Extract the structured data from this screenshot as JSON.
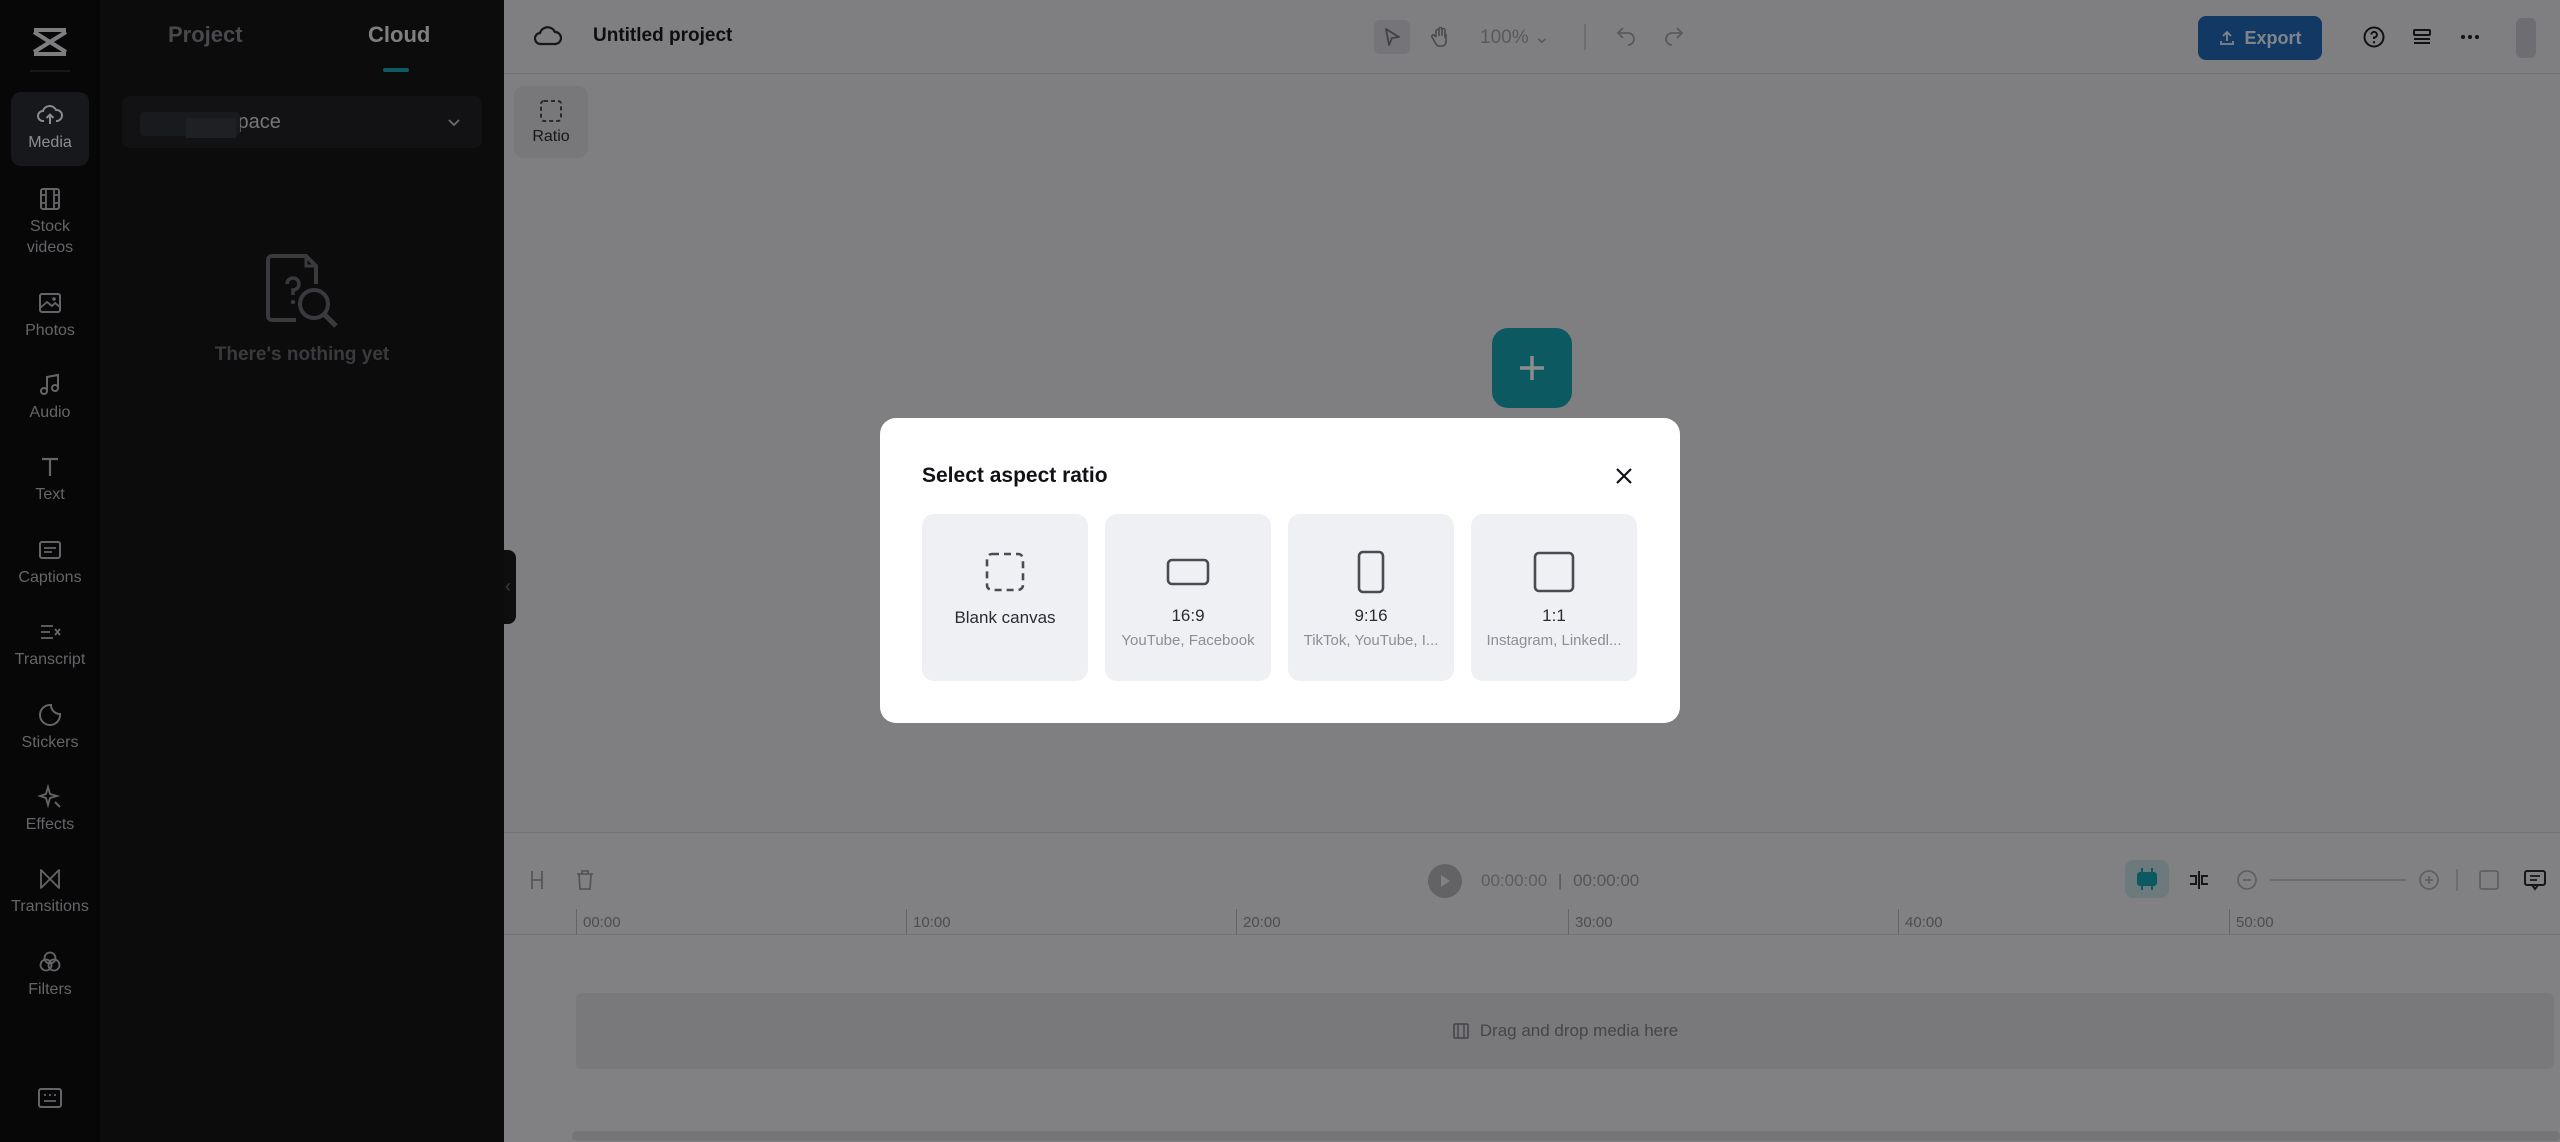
{
  "rail": {
    "items": [
      {
        "label": "Media",
        "icon": "cloud-upload-icon",
        "active": true
      },
      {
        "label": "Stock videos",
        "icon": "film-icon"
      },
      {
        "label": "Photos",
        "icon": "image-icon"
      },
      {
        "label": "Audio",
        "icon": "music-note-icon"
      },
      {
        "label": "Text",
        "icon": "text-icon"
      },
      {
        "label": "Captions",
        "icon": "captions-icon"
      },
      {
        "label": "Transcript",
        "icon": "transcript-icon"
      },
      {
        "label": "Stickers",
        "icon": "sticker-icon"
      },
      {
        "label": "Effects",
        "icon": "sparkle-icon"
      },
      {
        "label": "Transitions",
        "icon": "transition-icon"
      },
      {
        "label": "Filters",
        "icon": "filter-icon"
      }
    ]
  },
  "panel": {
    "tabs": [
      {
        "label": "Project"
      },
      {
        "label": "Cloud"
      }
    ],
    "space_label": "s space",
    "empty_text": "There's nothing yet"
  },
  "topbar": {
    "project_title": "Untitled project",
    "zoom": "100%",
    "export_label": "Export"
  },
  "ratio_chip": {
    "label": "Ratio"
  },
  "timeline": {
    "current_time": "00:00:00",
    "total_time": "00:00:00",
    "ruler_ticks": [
      "00:00",
      "10:00",
      "20:00",
      "30:00",
      "40:00",
      "50:00"
    ],
    "drop_hint": "Drag and drop media here"
  },
  "modal": {
    "title": "Select aspect ratio",
    "options": [
      {
        "name": "Blank canvas",
        "sub": ""
      },
      {
        "name": "16:9",
        "sub": "YouTube, Facebook"
      },
      {
        "name": "9:16",
        "sub": "TikTok, YouTube, I..."
      },
      {
        "name": "1:1",
        "sub": "Instagram, Linkedl..."
      }
    ]
  },
  "colors": {
    "accent": "#19a3b3",
    "export_button": "#2069b5",
    "rail_bg": "#0d0d0f",
    "panel_bg": "#161618"
  }
}
